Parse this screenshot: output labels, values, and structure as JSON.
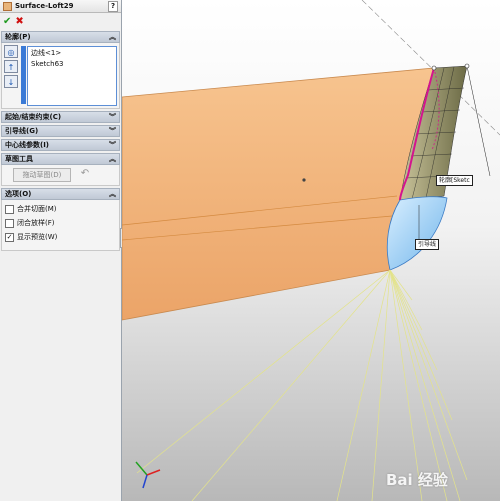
{
  "feature": {
    "title": "Surface-Loft29",
    "help": "?"
  },
  "actions": {
    "ok": "✔",
    "cancel": "✖"
  },
  "sections": {
    "profiles": {
      "label": "轮廓(P)",
      "items": [
        "边线<1>",
        "Sketch63"
      ]
    },
    "start_end": {
      "label": "起始/结束约束(C)"
    },
    "guide": {
      "label": "引导线(G)"
    },
    "centerline": {
      "label": "中心线参数(I)"
    },
    "sketch_tools": {
      "label": "草图工具",
      "drag_button": "拖动草图(D)"
    },
    "options": {
      "label": "选项(O)",
      "merge_tangent": {
        "label": "合并切面(M)",
        "checked": false
      },
      "close_loft": {
        "label": "闭合放样(F)",
        "checked": false
      },
      "show_preview": {
        "label": "显示预览(W)",
        "checked": true
      }
    }
  },
  "icons": {
    "title": "loft-icon",
    "profile_tool": "profile-selection-icon",
    "up": "move-up-icon",
    "down": "move-down-icon",
    "undo": "undo-icon",
    "collapse": "collapse-panel-icon"
  },
  "callouts": {
    "profile": "轮廓[Sketc",
    "guide": "引导线"
  },
  "colors": {
    "surface": "#f3b97e",
    "preview_blue": "#8fc8f2",
    "guide_magenta": "#d4148e"
  }
}
